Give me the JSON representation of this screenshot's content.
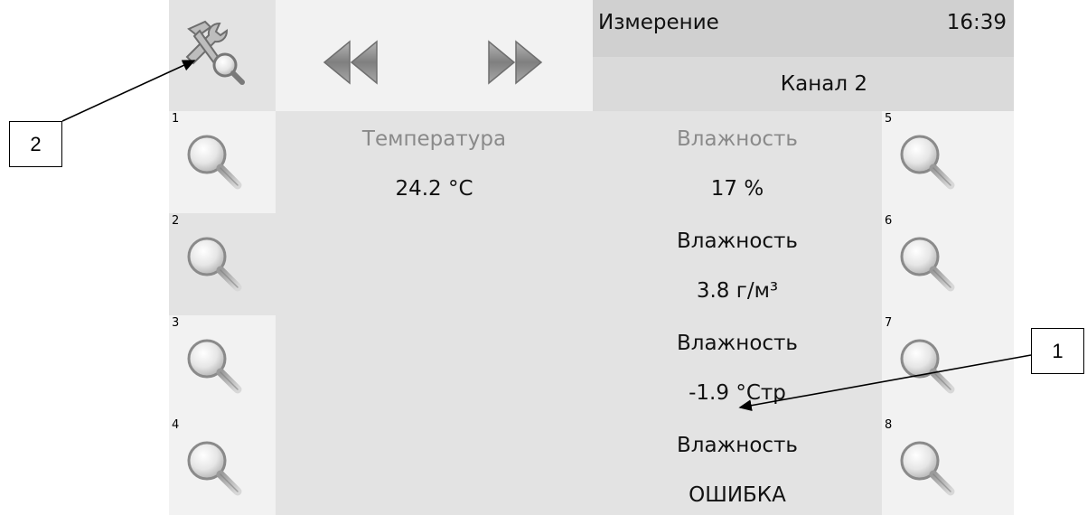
{
  "header": {
    "title": "Измерение",
    "time": "16:39",
    "channel": "Канал 2",
    "settings_icon": "tools-search-icon",
    "prev_icon": "double-left-arrow-icon",
    "next_icon": "double-right-arrow-icon"
  },
  "left_buttons": [
    {
      "number": "1",
      "icon": "magnifier-icon"
    },
    {
      "number": "2",
      "icon": "magnifier-icon"
    },
    {
      "number": "3",
      "icon": "magnifier-icon"
    },
    {
      "number": "4",
      "icon": "magnifier-icon"
    }
  ],
  "right_buttons": [
    {
      "number": "5",
      "icon": "magnifier-icon"
    },
    {
      "number": "6",
      "icon": "magnifier-icon"
    },
    {
      "number": "7",
      "icon": "magnifier-icon"
    },
    {
      "number": "8",
      "icon": "magnifier-icon"
    }
  ],
  "measurements": {
    "left": [
      {
        "label": "Температура",
        "value": "24.2 °C"
      }
    ],
    "right": [
      {
        "label": "Влажность",
        "value": "17 %"
      },
      {
        "label": "Влажность",
        "value": "3.8 г/м³"
      },
      {
        "label": "Влажность",
        "value": "-1.9 °Стр"
      },
      {
        "label": "Влажность",
        "value": "ОШИБКА"
      }
    ]
  },
  "callouts": {
    "left_label": "2",
    "right_label": "1"
  },
  "colors": {
    "panel_light": "#f2f2f2",
    "panel_mid": "#e3e3e3",
    "header_bar": "#d0d0d0",
    "inactive_text": "#8a8a8a",
    "arrow_gray": "#8c8c8c"
  }
}
